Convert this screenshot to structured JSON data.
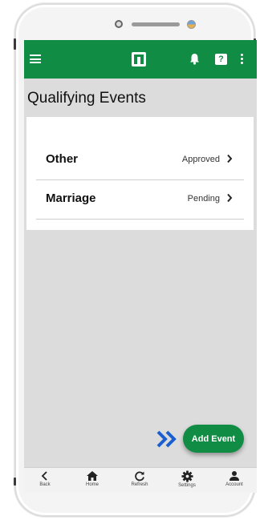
{
  "page": {
    "title": "Qualifying Events"
  },
  "events": [
    {
      "label": "Other",
      "status": "Approved"
    },
    {
      "label": "Marriage",
      "status": "Pending"
    }
  ],
  "actions": {
    "add_event_label": "Add Event"
  },
  "bottom_nav": [
    {
      "label": "Back",
      "icon": "back-icon"
    },
    {
      "label": "Home",
      "icon": "home-icon"
    },
    {
      "label": "Refresh",
      "icon": "refresh-icon"
    },
    {
      "label": "Settings",
      "icon": "settings-icon"
    },
    {
      "label": "Account",
      "icon": "account-icon"
    }
  ],
  "appbar": {
    "help_glyph": "?"
  },
  "colors": {
    "brand_green": "#118c44",
    "screen_background": "#dcdcdc",
    "hint_arrow_blue": "#1a5fd0"
  }
}
